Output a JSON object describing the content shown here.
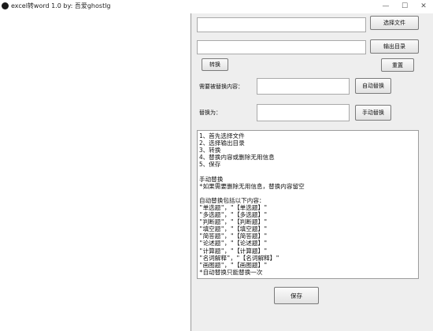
{
  "window": {
    "title": "excel转word 1.0 by: 吾爱ghostlg",
    "minimize_glyph": "—",
    "maximize_glyph": "☐",
    "close_glyph": "✕"
  },
  "source_file": {
    "value": "",
    "button_label": "选择文件"
  },
  "output_dir": {
    "value": "",
    "button_label": "输出目录"
  },
  "convert_button": "转换",
  "reset_button": "重置",
  "replace_target": {
    "label": "需要被替换内容：",
    "value": "",
    "button_label": "自动替换"
  },
  "replace_with": {
    "label": "替换为：",
    "value": "",
    "button_label": "手动替换"
  },
  "instructions": [
    "1、首先选择文件",
    "2、选择输出目录",
    "3、转换",
    "4、替换内容或删除无用信息",
    "5、保存",
    "",
    "手动替换",
    "*如果需要删除无用信息，替换内容留空",
    "",
    "自动替换包括以下内容：",
    "\"单选题\"，\"【单选题】\"",
    "\"多选题\"，\"【多选题】\"",
    "\"判断题\"，\"【判断题】\"",
    "\"填空题\"，\"【填空题】\"",
    "\"简答题\"，\"【简答题】\"",
    "\"论述题\"，\"【论述题】\"",
    "\"计算题\"，\"【计算题】\"",
    "\"名词解释\"，\"【名词解释】\"",
    "\"画图题\"，\"【画图题】\"",
    "*自动替换只能替换一次"
  ],
  "save_button": "保存"
}
